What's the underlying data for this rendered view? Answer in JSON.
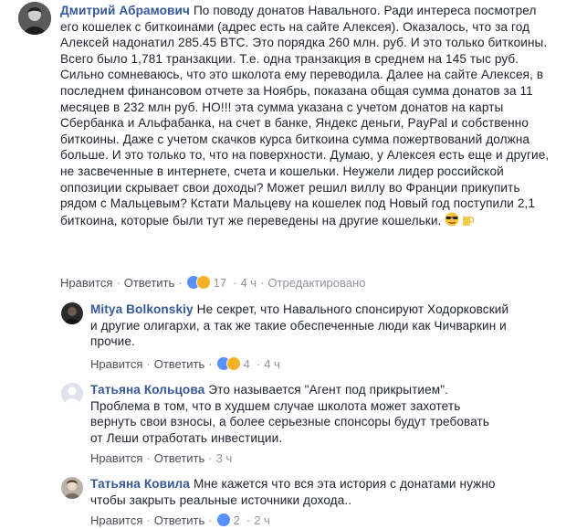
{
  "comments": [
    {
      "author": "Дмитрий Абрамович",
      "text": "По поводу донатов Навального. Ради интереса посмотрел его кошелек с биткоинами (адрес есть на сайте Алексея). Оказалось, что за год Алексей надонатил 285.45 BTC. Это порядка 260 млн. руб. И это только биткоины. Всего было 1,781 транзакции. Т.е. одна транзакция в среднем на 145 тыс руб. Сильно сомневаюсь, что это школота ему переводила. Далее на сайте Алексея, в последнем финансовом отчете за Ноябрь, показана общая сумма донатов за 11 месяцев в 232 млн руб. НО!!! эта сумма указана с учетом донатов на карты Сбербанка и Альфабанка, на счет в банке, Яндекс деньги, PayPal и собственно биткоины. Даже с учетом скачков курса биткоина сумма пожертвований должна больше. И это только то, что на поверхности. Думаю, у Алексея есть еще и другие, не засвеченные в интернете, счета и кошельки. Неужели лидер российской оппозиции скрывает свои доходы? Может решил виллу во Франции прикупить рядом с Мальцевым? Кстати Мальцеву на кошелек под Новый год поступили 2,1 биткоина, которые были тут же переведены на другие кошельки.",
      "like": "Нравится",
      "reply": "Ответить",
      "reactions": "17",
      "time": "4 ч",
      "edited": "Отредактировано"
    },
    {
      "author": "Mitya Bolkonskiy",
      "text": "Не секрет, что Навального спонсируют Ходорковский и другие олигархи, а так же такие обеспеченные люди как Чичваркин и прочие.",
      "like": "Нравится",
      "reply": "Ответить",
      "reactions": "4",
      "time": "4 ч"
    },
    {
      "author": "Татьяна Кольцова",
      "text": "Это называется \"Агент под прикрытием\". Проблема в том, что в худшем случае школота может захотеть вернуть свои взносы, а более серьезные спонсоры будут требовать от Леши отработать инвестиции.",
      "like": "Нравится",
      "reply": "Ответить",
      "time": "3 ч"
    },
    {
      "author": "Татьяна Ковила",
      "text": "Мне кажется что вся эта история с донатами нужно чтобы закрыть реальные источники дохода..",
      "like": "Нравится",
      "reply": "Ответить",
      "reactions": "2",
      "time": "2 ч"
    }
  ],
  "colors": {
    "author": "#365899",
    "meta": "#90949c",
    "like_reaction": "#5890ff",
    "wow_reaction": "#f7b125"
  },
  "icons": [
    "avatar",
    "like-reaction-icon",
    "wow-reaction-icon",
    "sunglasses-emoji-icon",
    "beer-emoji-icon"
  ]
}
